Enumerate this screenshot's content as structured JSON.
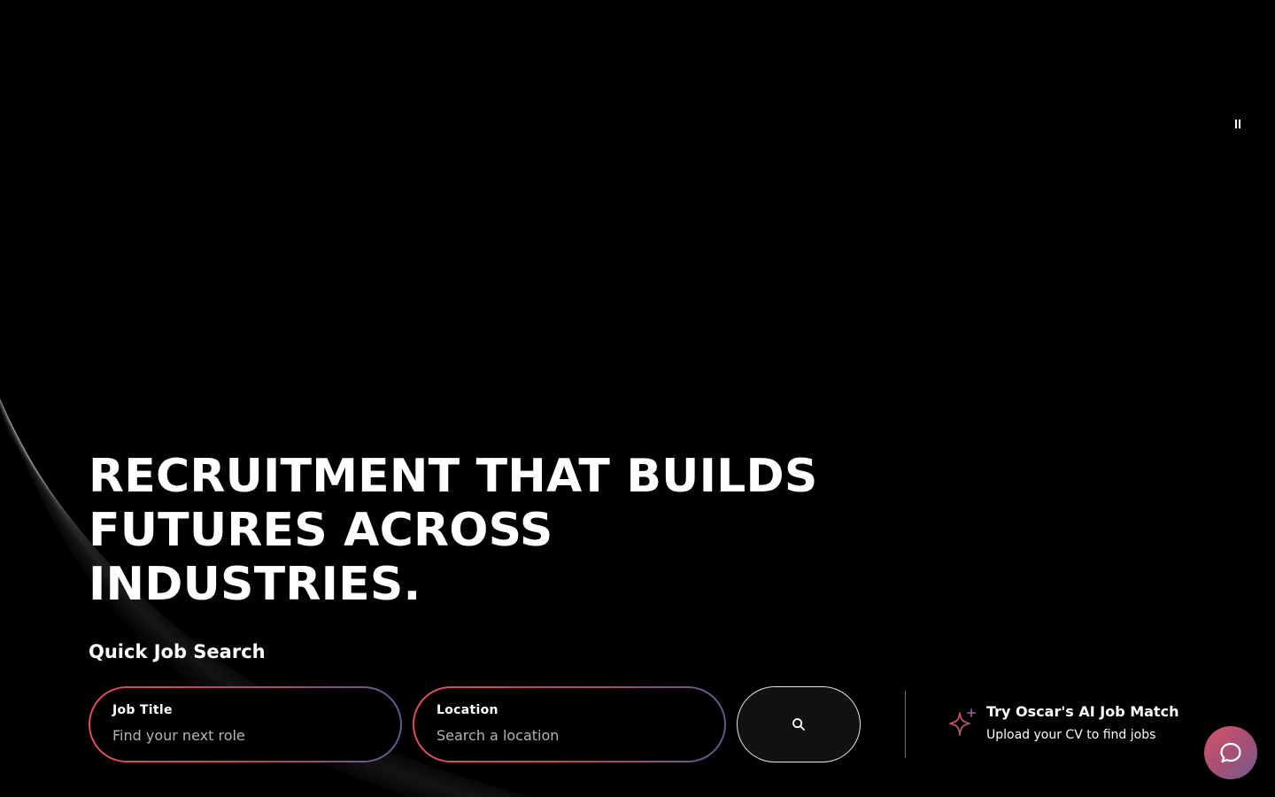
{
  "hero": {
    "headline": "RECRUITMENT THAT BUILDS FUTURES ACROSS INDUSTRIES.",
    "pause_icon": "pause-icon"
  },
  "quick_search": {
    "title": "Quick Job Search",
    "job_title": {
      "label": "Job Title",
      "placeholder": "Find your next role",
      "value": ""
    },
    "location": {
      "label": "Location",
      "placeholder": "Search a location",
      "value": ""
    },
    "search_icon": "search-icon"
  },
  "ai_match": {
    "title": "Try Oscar's AI Job Match",
    "subtitle": "Upload your CV to find jobs",
    "icon": "sparkle-icon"
  },
  "chat": {
    "icon": "chat-bubble-icon"
  },
  "colors": {
    "background": "#000000",
    "text": "#ffffff",
    "gradient_start": "#e0505e",
    "gradient_mid": "#b0486f",
    "gradient_end": "#5e5c8a",
    "placeholder": "#b4b4b4"
  }
}
